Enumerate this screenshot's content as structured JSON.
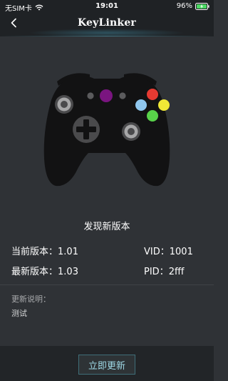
{
  "status_bar": {
    "carrier": "无SIM卡",
    "time": "19:01",
    "battery": "96%"
  },
  "nav": {
    "title": "KeyLinker"
  },
  "update": {
    "headline": "发现新版本",
    "current_version_label": "当前版本：",
    "current_version_value": "1.01",
    "latest_version_label": "最新版本：",
    "latest_version_value": "1.03",
    "vid_label": "VID：",
    "vid_value": "1001",
    "pid_label": "PID：",
    "pid_value": "2fff",
    "notes_label": "更新说明：",
    "notes_text": "测试",
    "button_label": "立即更新"
  },
  "icons": {
    "back": "chevron-left-icon",
    "wifi": "wifi-icon",
    "battery": "battery-charging-icon",
    "controller": "gamepad-icon"
  },
  "colors": {
    "background": "#2f3236",
    "header_background": "#1f2225",
    "controller_body": "#121213",
    "button_red": "#e63a32",
    "button_yellow": "#f0e836",
    "button_green": "#58d24a",
    "button_blue": "#8fc7ee",
    "home_button_purple": "#7a1580",
    "update_button_text": "#9fd9e6"
  }
}
